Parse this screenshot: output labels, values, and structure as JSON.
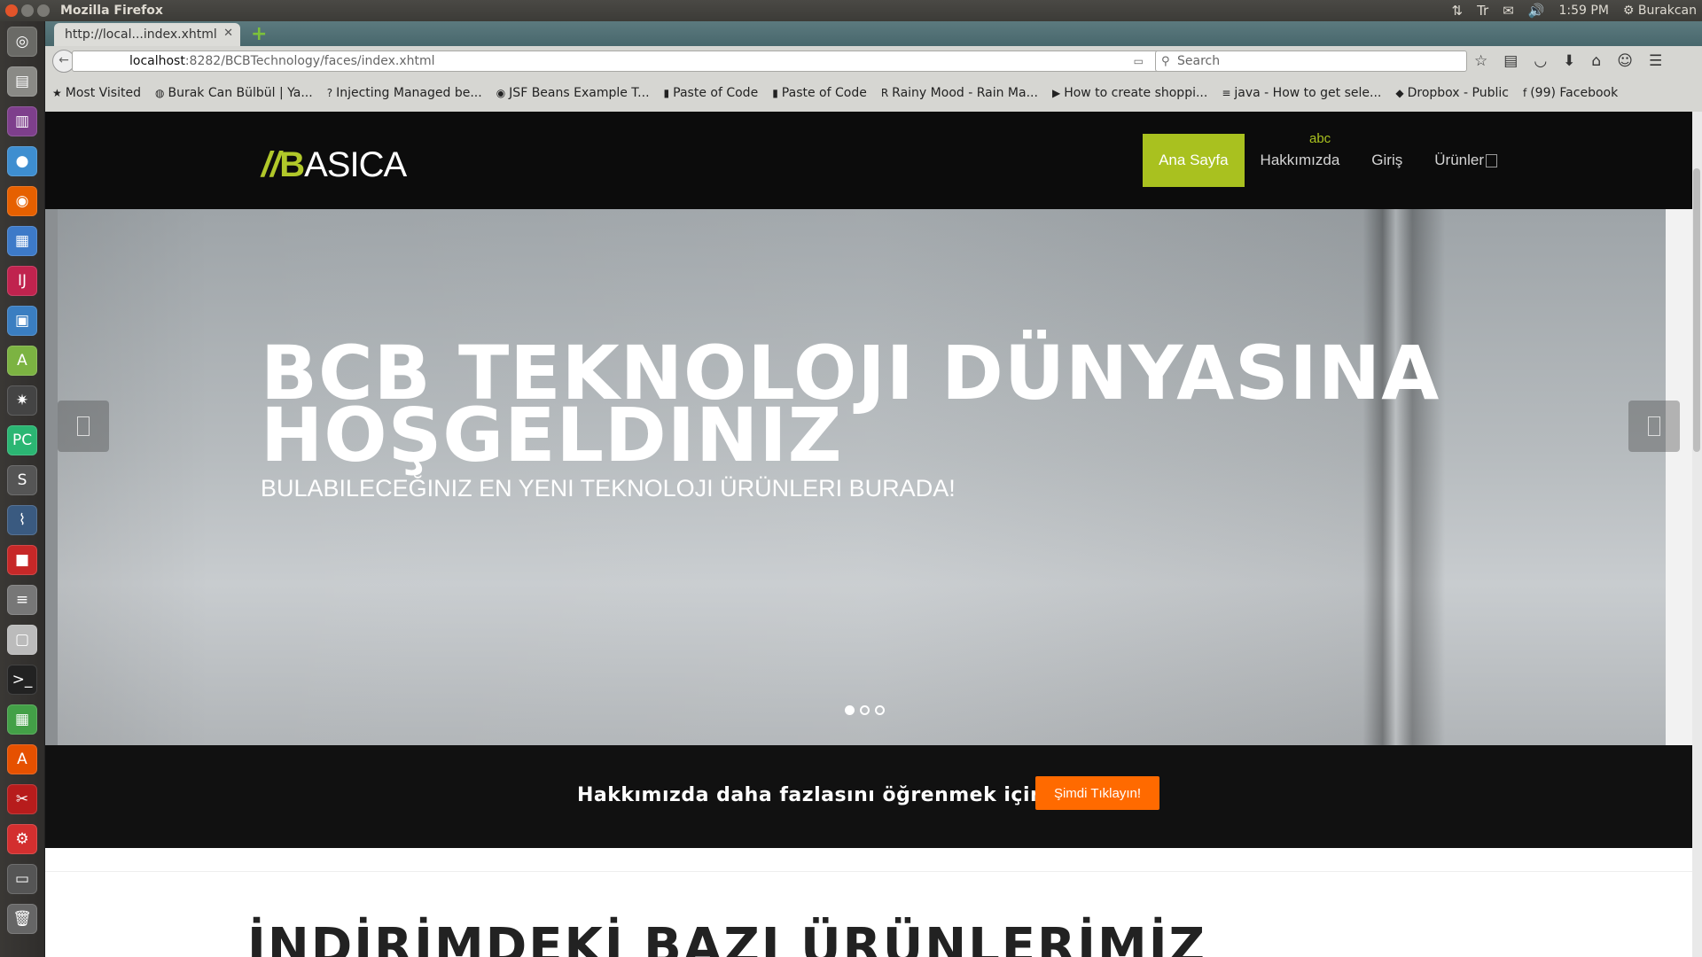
{
  "system": {
    "window_title": "Mozilla Firefox",
    "time": "1:59 PM",
    "user": "Burakcan"
  },
  "browser": {
    "tab_title": "http://local...index.xhtml",
    "url_host": "localhost",
    "url_rest": ":8282/BCBTechnology/faces/index.xhtml",
    "search_placeholder": "Search",
    "bookmarks": [
      {
        "label": "Most Visited",
        "icon": "star-icon"
      },
      {
        "label": "Burak Can Bülbül | Ya...",
        "icon": "globe-icon"
      },
      {
        "label": "Injecting Managed be...",
        "icon": "question-icon"
      },
      {
        "label": "JSF Beans Example T...",
        "icon": "tutorial-icon"
      },
      {
        "label": "Paste of Code",
        "icon": "paste-icon"
      },
      {
        "label": "Paste of Code",
        "icon": "paste-icon"
      },
      {
        "label": "Rainy Mood - Rain Ma...",
        "icon": "r-icon"
      },
      {
        "label": "How to create shoppi...",
        "icon": "youtube-icon"
      },
      {
        "label": "java - How to get sele...",
        "icon": "stackoverflow-icon"
      },
      {
        "label": "Dropbox - Public",
        "icon": "dropbox-icon"
      },
      {
        "label": "(99) Facebook",
        "icon": "facebook-icon"
      }
    ]
  },
  "site": {
    "logo_prefix": "//",
    "logo_b": "B",
    "logo_rest": "ASICA",
    "nav": [
      {
        "label": "Ana Sayfa",
        "active": true
      },
      {
        "label": "Hakkımızda",
        "active": false
      },
      {
        "label": "Giriş",
        "active": false
      },
      {
        "label": "Ürünler",
        "active": false
      }
    ],
    "nav_badge": "abc",
    "hero": {
      "title": "BCB TEKNOLOJI DÜNYASINA HOŞGELDINIZ",
      "subtitle": "BULABILECEĞINIZ EN YENI TEKNOLOJI ÜRÜNLERI BURADA!",
      "slide_count": 3,
      "active_slide": 1
    },
    "cta": {
      "text": "Hakkımızda daha fazlasını öğrenmek için",
      "button": "Şimdi Tıklayın!"
    },
    "section_title": "İNDİRİMDEKİ BAZI ÜRÜNLERİMİZ"
  },
  "colors": {
    "accent_green": "#a9c11f",
    "cta_orange": "#ff6a00",
    "header_bg": "#0c0c0c"
  }
}
